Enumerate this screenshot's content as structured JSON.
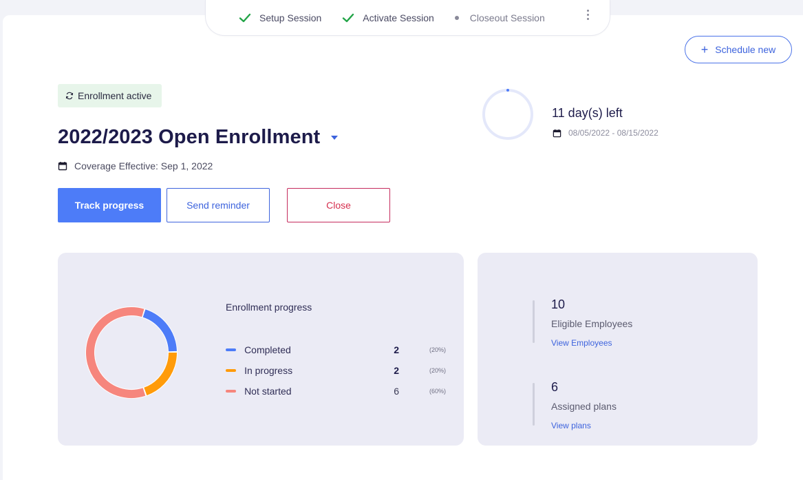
{
  "stepper": {
    "steps": [
      {
        "label": "Setup Session",
        "status": "done"
      },
      {
        "label": "Activate Session",
        "status": "done"
      },
      {
        "label": "Closeout Session",
        "status": "pending"
      }
    ]
  },
  "actions": {
    "schedule_new": "Schedule new"
  },
  "enrollment": {
    "badge": "Enrollment active",
    "title": "2022/2023 Open Enrollment",
    "coverage": "Coverage Effective: Sep 1, 2022",
    "days_left": "11 day(s) left",
    "date_range": "08/05/2022 - 08/15/2022",
    "buttons": {
      "track": "Track progress",
      "remind": "Send reminder",
      "close": "Close"
    }
  },
  "progress": {
    "title": "Enrollment progress",
    "rows": [
      {
        "label": "Completed",
        "count": "2",
        "pct": "(20%)",
        "color": "#4d7cf8",
        "fraction": 0.2
      },
      {
        "label": "In progress",
        "count": "2",
        "pct": "(20%)",
        "color": "#ff9b0a",
        "fraction": 0.2
      },
      {
        "label": "Not started",
        "count": "6",
        "pct": "(60%)",
        "color": "#f6867d",
        "fraction": 0.6
      }
    ]
  },
  "stats": [
    {
      "number": "10",
      "label": "Eligible Employees",
      "link": "View Employees"
    },
    {
      "number": "6",
      "label": "Assigned plans",
      "link": "View plans"
    }
  ],
  "colors": {
    "accent": "#4d7cf8",
    "danger": "#d6304f",
    "badge_bg": "#e7f5ea",
    "card_bg": "#ebebf5"
  }
}
